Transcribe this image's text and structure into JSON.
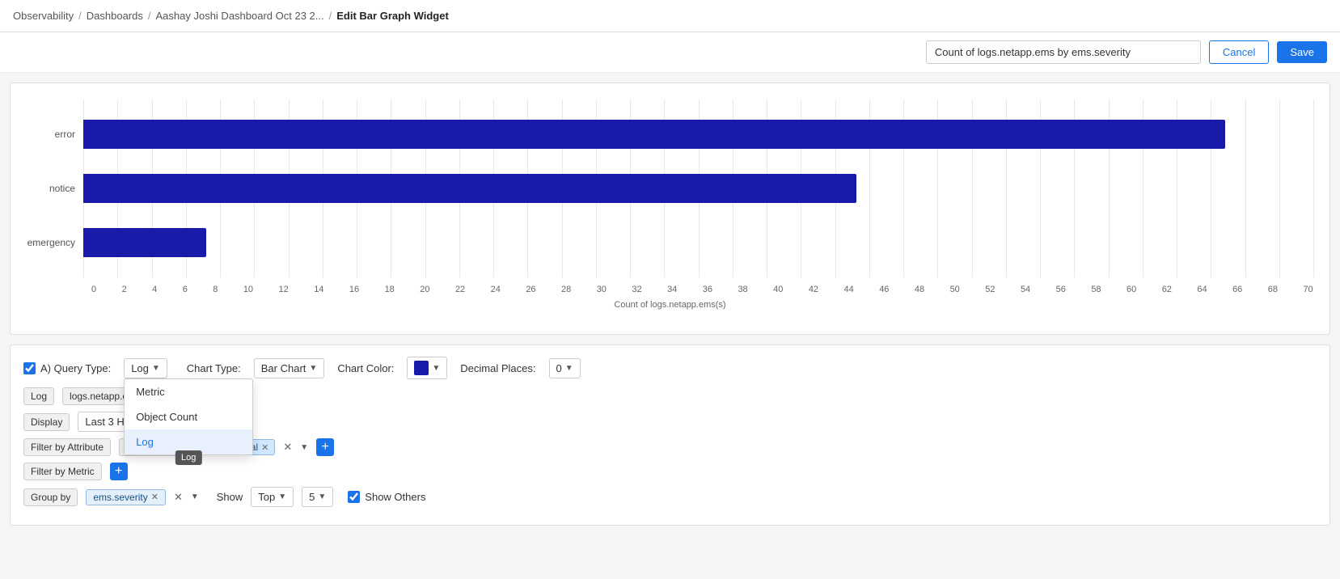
{
  "breadcrumb": {
    "items": [
      {
        "label": "Observability",
        "sep": true
      },
      {
        "label": "Dashboards",
        "sep": true
      },
      {
        "label": "Aashay Joshi Dashboard Oct 23 2...",
        "sep": true
      },
      {
        "label": "Edit Bar Graph Widget",
        "current": true
      }
    ]
  },
  "header": {
    "title_input_value": "Count of logs.netapp.ems by ems.severity",
    "cancel_label": "Cancel",
    "save_label": "Save"
  },
  "chart": {
    "bars": [
      {
        "label": "error",
        "value": 65,
        "max": 70
      },
      {
        "label": "notice",
        "value": 44,
        "max": 70
      },
      {
        "label": "emergency",
        "value": 7,
        "max": 70
      }
    ],
    "x_axis": [
      "0",
      "2",
      "4",
      "6",
      "8",
      "10",
      "12",
      "14",
      "16",
      "18",
      "20",
      "22",
      "24",
      "26",
      "28",
      "30",
      "32",
      "34",
      "36",
      "38",
      "40",
      "42",
      "44",
      "46",
      "48",
      "50",
      "52",
      "54",
      "56",
      "58",
      "60",
      "62",
      "64",
      "66",
      "68",
      "70"
    ],
    "x_title": "Count of logs.netapp.ems(s)"
  },
  "config": {
    "query_type_label": "A) Query Type:",
    "query_type_value": "Log",
    "chart_type_label": "Chart Type:",
    "chart_type_value": "Bar Chart",
    "chart_color_label": "Chart Color:",
    "decimal_places_label": "Decimal Places:",
    "decimal_places_value": "0",
    "log_tag": "Log",
    "source_tag": "logs.netapp.ems",
    "display_label": "Display",
    "display_value": "Last 3 Hours",
    "filter_attribute_label": "Filter by Attribute",
    "filter_attribute_value": "ems.severity",
    "filter_attr_tag": "informational",
    "filter_metric_label": "Filter by Metric",
    "group_by_label": "Group by",
    "group_by_tag": "ems.severity",
    "show_label": "Show",
    "top_value": "Top",
    "num_value": "5",
    "show_others_label": "Show Others",
    "dropdown_items": [
      {
        "label": "Metric",
        "active": false
      },
      {
        "label": "Object Count",
        "active": false
      },
      {
        "label": "Log",
        "active": true
      }
    ],
    "tooltip_log": "Log"
  }
}
